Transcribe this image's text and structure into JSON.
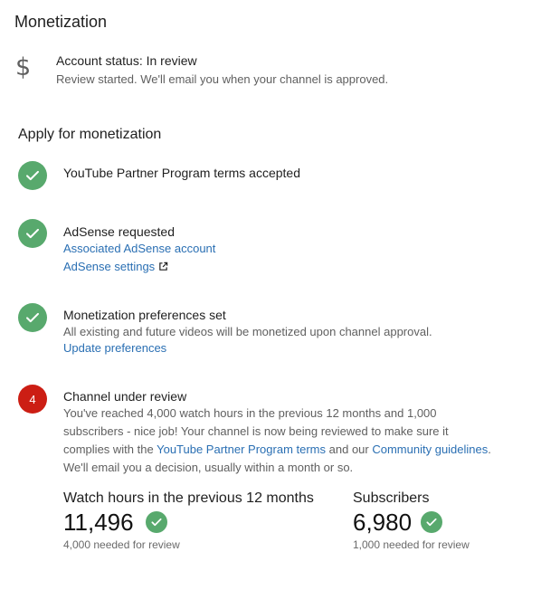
{
  "page": {
    "title": "Monetization"
  },
  "account_status": {
    "icon": "dollar-icon",
    "title": "Account status: In review",
    "description": "Review started. We'll email you when your channel is approved."
  },
  "apply": {
    "title": "Apply for monetization",
    "steps": [
      {
        "status": "done",
        "title": "YouTube Partner Program terms accepted"
      },
      {
        "status": "done",
        "title": "AdSense requested",
        "links": [
          "Associated AdSense account",
          "AdSense settings"
        ]
      },
      {
        "status": "done",
        "title": "Monetization preferences set",
        "description": "All existing and future videos will be monetized upon channel approval.",
        "links": [
          "Update preferences"
        ]
      },
      {
        "status": "current",
        "number": "4",
        "title": "Channel under review",
        "text_lines": [
          "You've reached 4,000 watch hours in the previous 12 months and 1,000",
          "subscribers - nice job! Your channel is now being reviewed to make sure it",
          "complies with the",
          "and our",
          "We'll email you a decision, usually within a month or so."
        ],
        "inline_links": [
          "YouTube Partner Program terms",
          "Community guidelines"
        ],
        "period": "."
      }
    ]
  },
  "metrics": [
    {
      "label": "Watch hours in the previous 12 months",
      "value": "11,496",
      "note": "4,000 needed for review"
    },
    {
      "label": "Subscribers",
      "value": "6,980",
      "note": "1,000 needed for review"
    }
  ],
  "colors": {
    "check_green": "#58a96d",
    "current_red": "#cc1e14",
    "link_blue": "#2a6fb3",
    "secondary_text": "#606060"
  }
}
